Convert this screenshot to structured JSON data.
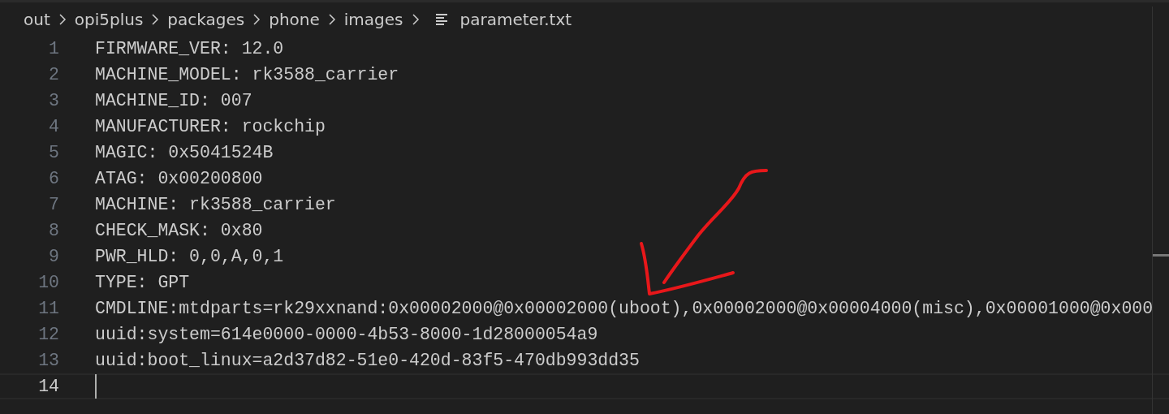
{
  "breadcrumbs": [
    {
      "label": "out",
      "kind": "folder"
    },
    {
      "label": "opi5plus",
      "kind": "folder"
    },
    {
      "label": "packages",
      "kind": "folder"
    },
    {
      "label": "phone",
      "kind": "folder"
    },
    {
      "label": "images",
      "kind": "folder"
    },
    {
      "label": "parameter.txt",
      "kind": "file"
    }
  ],
  "editor": {
    "lines": [
      {
        "number": "1",
        "text": "FIRMWARE_VER: 12.0",
        "current": false
      },
      {
        "number": "2",
        "text": "MACHINE_MODEL: rk3588_carrier",
        "current": false
      },
      {
        "number": "3",
        "text": "MACHINE_ID: 007",
        "current": false
      },
      {
        "number": "4",
        "text": "MANUFACTURER: rockchip",
        "current": false
      },
      {
        "number": "5",
        "text": "MAGIC: 0x5041524B",
        "current": false
      },
      {
        "number": "6",
        "text": "ATAG: 0x00200800",
        "current": false
      },
      {
        "number": "7",
        "text": "MACHINE: rk3588_carrier",
        "current": false
      },
      {
        "number": "8",
        "text": "CHECK_MASK: 0x80",
        "current": false
      },
      {
        "number": "9",
        "text": "PWR_HLD: 0,0,A,0,1",
        "current": false
      },
      {
        "number": "10",
        "text": "TYPE: GPT",
        "current": false
      },
      {
        "number": "11",
        "text": "CMDLINE:mtdparts=rk29xxnand:0x00002000@0x00002000(uboot),0x00002000@0x00004000(misc),0x00001000@0x000",
        "current": false
      },
      {
        "number": "12",
        "text": "uuid:system=614e0000-0000-4b53-8000-1d28000054a9",
        "current": false
      },
      {
        "number": "13",
        "text": "uuid:boot_linux=a2d37d82-51e0-420d-83f5-470db993dd35",
        "current": false
      },
      {
        "number": "14",
        "current": true
      }
    ]
  }
}
